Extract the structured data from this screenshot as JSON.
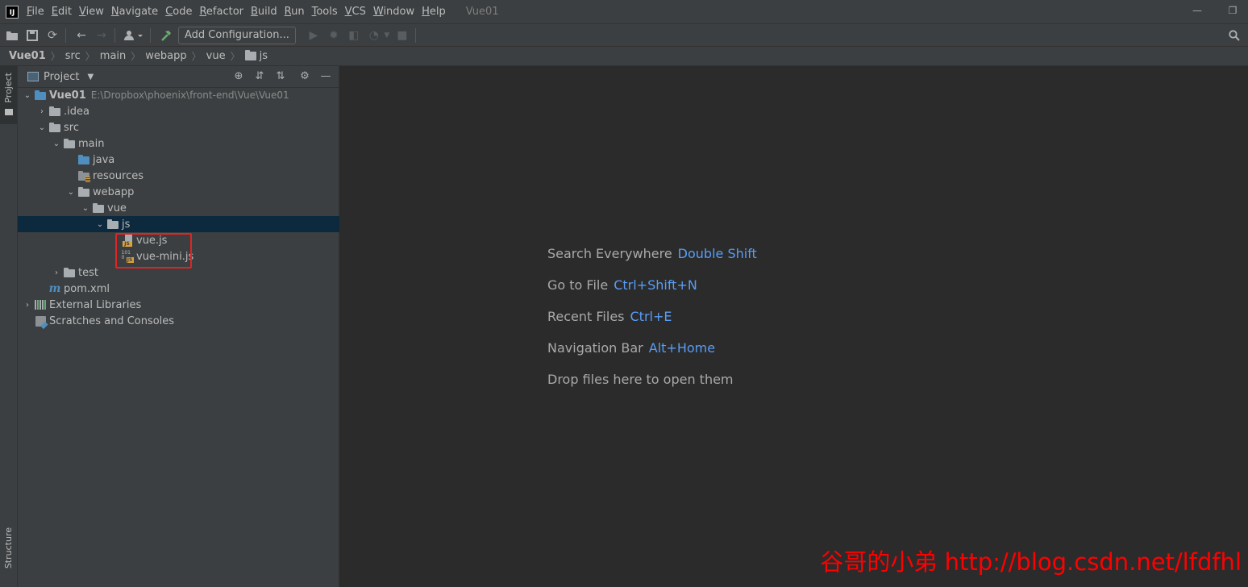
{
  "menubar": {
    "logo": "IJ",
    "items": [
      "File",
      "Edit",
      "View",
      "Navigate",
      "Code",
      "Refactor",
      "Build",
      "Run",
      "Tools",
      "VCS",
      "Window",
      "Help"
    ],
    "window_title": "Vue01"
  },
  "toolbar": {
    "add_configuration_label": "Add Configuration..."
  },
  "breadcrumb": {
    "items": [
      "Vue01",
      "src",
      "main",
      "webapp",
      "vue",
      "js"
    ]
  },
  "side_tabs": {
    "project": "Project",
    "structure": "Structure"
  },
  "project_panel": {
    "title": "Project"
  },
  "tree": {
    "root_name": "Vue01",
    "root_path": "E:\\Dropbox\\phoenix\\front-end\\Vue\\Vue01",
    "idea": ".idea",
    "src": "src",
    "main": "main",
    "java": "java",
    "resources": "resources",
    "webapp": "webapp",
    "vue": "vue",
    "js": "js",
    "vue_js": "vue.js",
    "vue_mini_js": "vue-mini.js",
    "test": "test",
    "pom": "pom.xml",
    "external_libraries": "External Libraries",
    "scratches": "Scratches and Consoles"
  },
  "editor_hints": [
    {
      "label": "Search Everywhere",
      "key": "Double Shift"
    },
    {
      "label": "Go to File",
      "key": "Ctrl+Shift+N"
    },
    {
      "label": "Recent Files",
      "key": "Ctrl+E"
    },
    {
      "label": "Navigation Bar",
      "key": "Alt+Home"
    },
    {
      "label": "Drop files here to open them",
      "key": ""
    }
  ],
  "watermark": "谷哥的小弟 http://blog.csdn.net/lfdfhl",
  "colors": {
    "background": "#2b2b2b",
    "panel": "#3c3f41",
    "selection": "#0d293e",
    "shortcut": "#589df6",
    "highlight": "#e02424",
    "watermark": "#ff0000"
  }
}
